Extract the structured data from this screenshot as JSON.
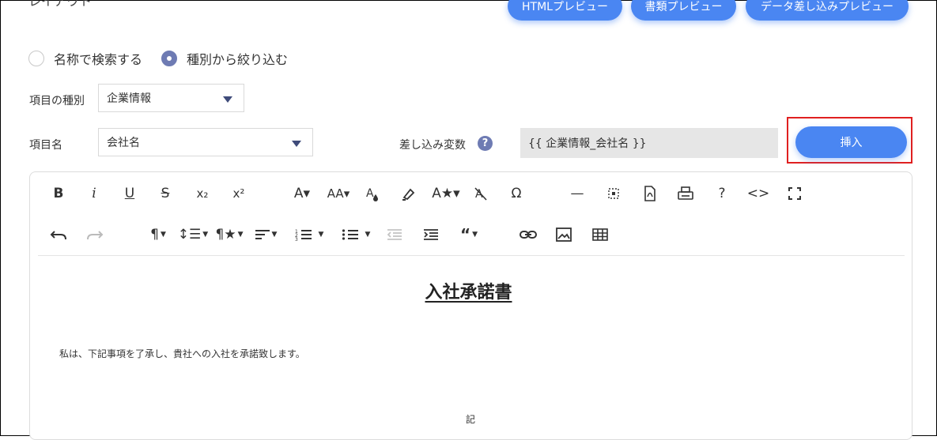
{
  "header": {
    "title": "レイアウト",
    "buttons": [
      "HTMLプレビュー",
      "書類プレビュー",
      "データ差し込みプレビュー"
    ]
  },
  "search_mode": {
    "options": [
      "名称で検索する",
      "種別から絞り込む"
    ],
    "selected": "種別から絞り込む"
  },
  "form": {
    "category_label": "項目の種別",
    "category_value": "企業情報",
    "item_label": "項目名",
    "item_value": "会社名",
    "variable_label": "差し込み変数",
    "variable_value": "{{ 企業情報_会社名 }}",
    "insert_label": "挿入",
    "help_glyph": "?"
  },
  "toolbar": {
    "row1": [
      "B",
      "i",
      "U",
      "S",
      "x₂",
      "x²",
      "A▾",
      "AA▾",
      "drop",
      "highlighter",
      "A★▾",
      "clear-format",
      "Ω",
      "—",
      "page-break",
      "pdf",
      "print",
      "?",
      "<>",
      "fullscreen"
    ],
    "row2": [
      "undo",
      "redo",
      "¶▾",
      "line-height▾",
      "¶★▾",
      "align▾",
      "ordered-list▾",
      "bullet-list▾",
      "outdent",
      "indent",
      "quote▾",
      "link",
      "image",
      "table"
    ]
  },
  "document": {
    "title": "入社承諾書",
    "body": "私は、下記事項を了承し、貴社への入社を承諾致します。",
    "ki": "記"
  },
  "colors": {
    "accent": "#4a86f2",
    "radio_checked": "#6e7bb3",
    "highlight_border": "#e02020"
  }
}
